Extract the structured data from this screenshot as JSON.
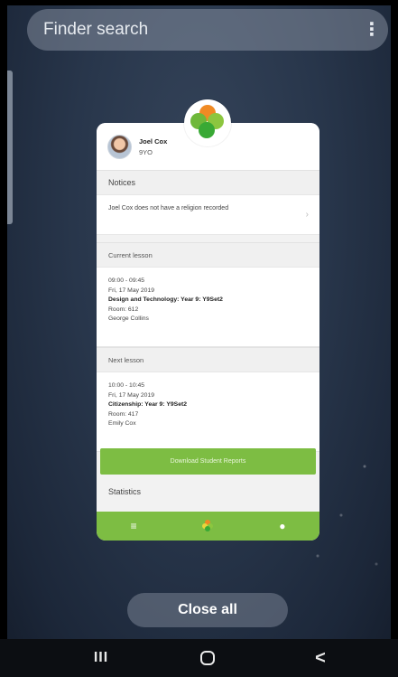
{
  "search": {
    "label": "Finder search",
    "more_icon": "more-vert-icon"
  },
  "card": {
    "profile": {
      "name": "Joel Cox",
      "year": "9YO"
    },
    "notices": {
      "heading": "Notices",
      "item": "Joel Cox does not have a religion recorded"
    },
    "current_lesson": {
      "heading": "Current lesson",
      "time": "09:00 - 09:45",
      "date": "Fri, 17 May 2019",
      "subject": "Design and Technology: Year 9: Y9Set2",
      "room": "Room: 612",
      "teacher": "George Collins"
    },
    "next_lesson": {
      "heading": "Next lesson",
      "time": "10:00 - 10:45",
      "date": "Fri, 17 May 2019",
      "subject": "Citizenship: Year 9: Y9Set2",
      "room": "Room: 417",
      "teacher": "Emily Cox"
    },
    "download_label": "Download Student Reports",
    "statistics_heading": "Statistics",
    "tabbar": {
      "menu_icon": "≡",
      "profile_icon": "●"
    }
  },
  "close_all_label": "Close all",
  "navbar": {
    "recent": "III",
    "back": "<"
  },
  "colors": {
    "accent_green": "#7dbd43",
    "logo_orange": "#f08a24",
    "logo_green": "#8cc63f",
    "logo_dark_green": "#39a935"
  }
}
